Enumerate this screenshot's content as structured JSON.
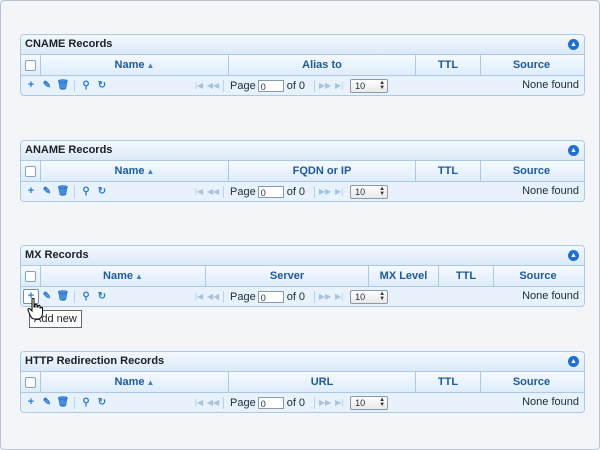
{
  "panels": [
    {
      "title": "CNAME Records",
      "columns": [
        "Name",
        "Alias to",
        "TTL",
        "Source"
      ],
      "sort_column": "Name",
      "page_label": "Page",
      "page_value": "0",
      "of_label": "of 0",
      "page_size": "10",
      "status": "None found"
    },
    {
      "title": "ANAME Records",
      "columns": [
        "Name",
        "FQDN or IP",
        "TTL",
        "Source"
      ],
      "sort_column": "Name",
      "page_label": "Page",
      "page_value": "0",
      "of_label": "of 0",
      "page_size": "10",
      "status": "None found"
    },
    {
      "title": "MX Records",
      "columns": [
        "Name",
        "Server",
        "MX Level",
        "TTL",
        "Source"
      ],
      "sort_column": "Name",
      "page_label": "Page",
      "page_value": "0",
      "of_label": "of 0",
      "page_size": "10",
      "status": "None found",
      "tooltip": "Add new"
    },
    {
      "title": "HTTP Redirection Records",
      "columns": [
        "Name",
        "URL",
        "TTL",
        "Source"
      ],
      "sort_column": "Name",
      "page_label": "Page",
      "page_value": "0",
      "of_label": "of 0",
      "page_size": "10",
      "status": "None found"
    }
  ],
  "icons": {
    "collapse": "chevron-up-icon",
    "add": "plus-icon",
    "edit": "pencil-icon",
    "delete": "trash-icon",
    "search": "magnifier-icon",
    "refresh": "refresh-icon",
    "first": "first-page-icon",
    "prev": "previous-page-icon",
    "next": "next-page-icon",
    "last": "last-page-icon"
  },
  "colors": {
    "panel_border": "#a9c9e6",
    "panel_bg": "#eaf4fd",
    "header_text": "#1e5a99",
    "icon_blue": "#2a79d0"
  }
}
